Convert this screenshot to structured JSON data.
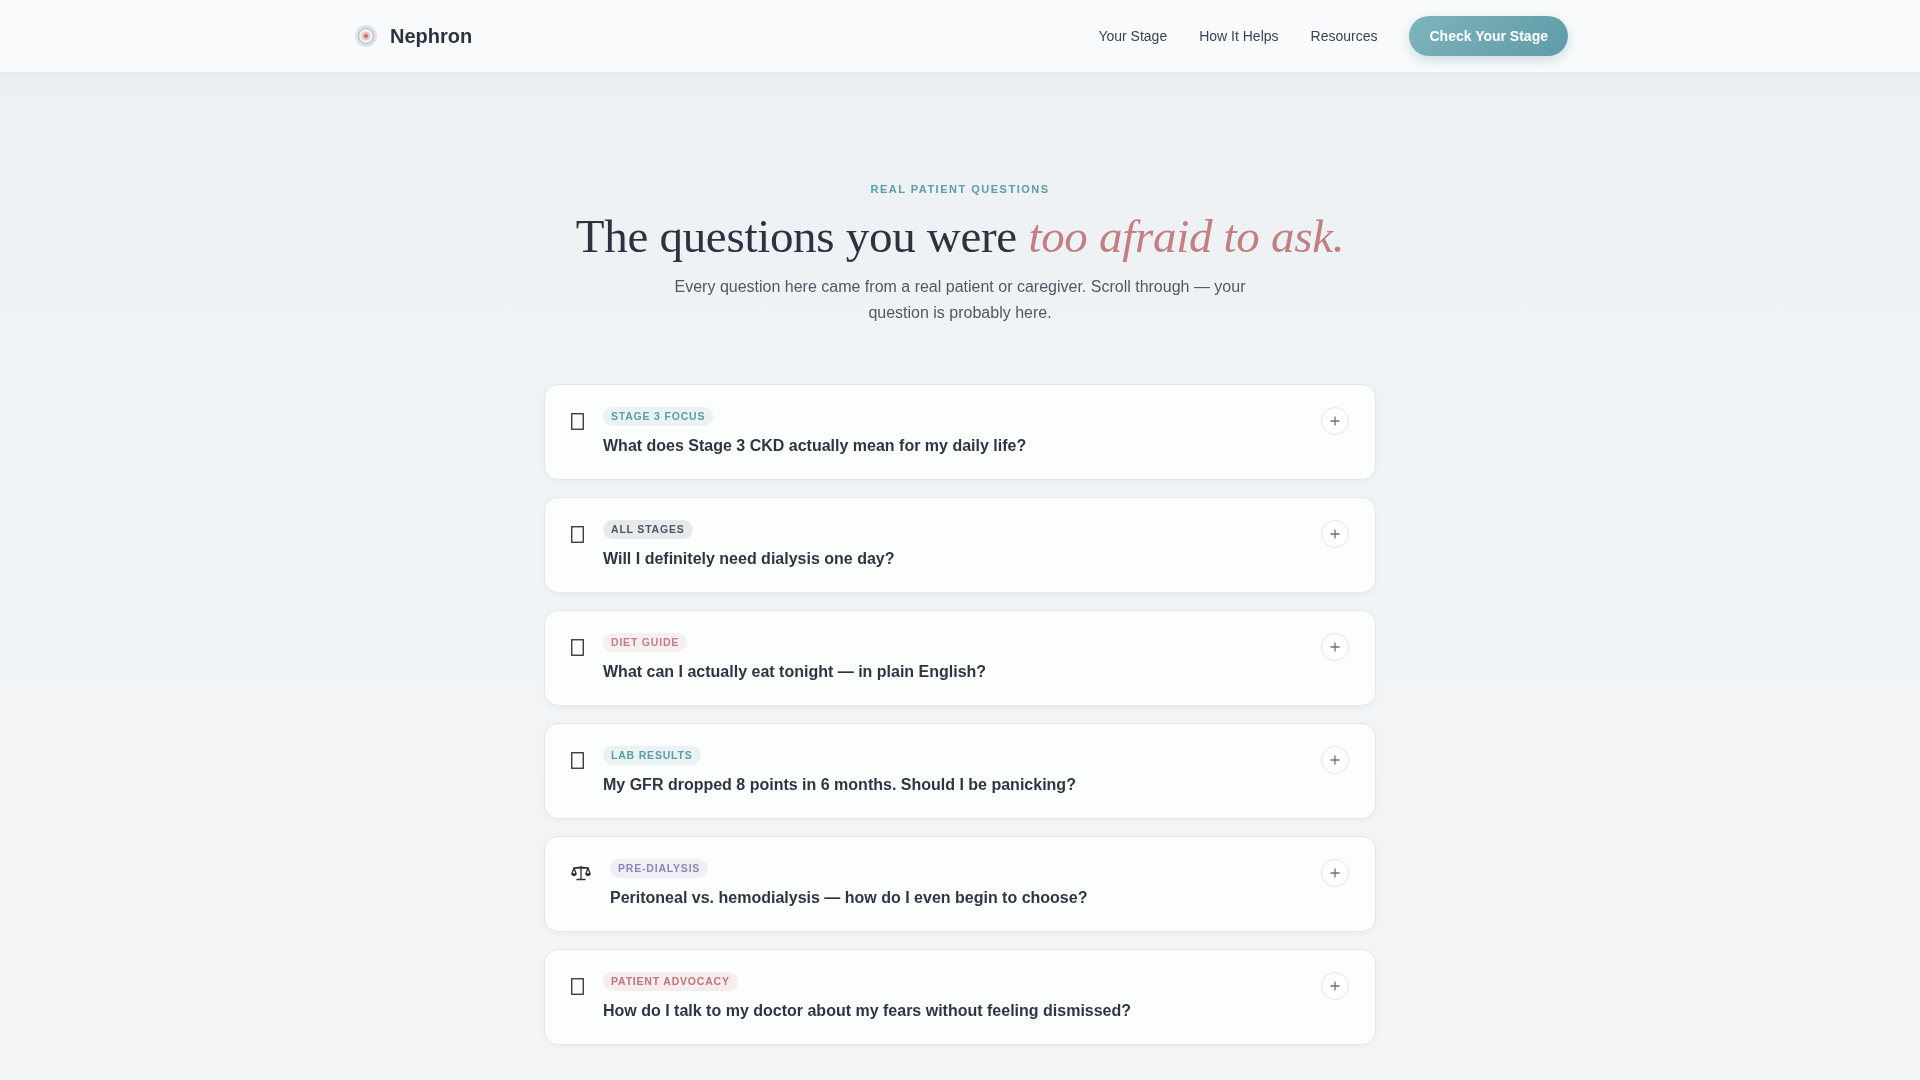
{
  "header": {
    "brand": "Nephron",
    "nav": [
      "Your Stage",
      "How It Helps",
      "Resources"
    ],
    "cta": "Check Your Stage"
  },
  "hero": {
    "eyebrow": "REAL PATIENT QUESTIONS",
    "title": "The questions you were *too afraid to ask.*",
    "subtitle": "Every question here came from a real patient or caregiver. Scroll through — your question is probably here."
  },
  "questions": [
    {
      "kind": "boxed",
      "tag": "STAGE 3 FOCUS",
      "color": "#5a9ea8",
      "question": "What does Stage 3 CKD actually mean for my daily life?",
      "expanded": false
    },
    {
      "kind": "boxed",
      "tag": "ALL STAGES",
      "color": "#4b5563",
      "question": "Will I definitely need dialysis one day?",
      "expanded": false
    },
    {
      "kind": "boxed",
      "tag": "DIET GUIDE",
      "color": "#c07f86",
      "question": "What can I actually eat tonight — in plain English?",
      "expanded": false
    },
    {
      "kind": "boxed",
      "tag": "LAB RESULTS",
      "color": "#5a9ea8",
      "question": "My GFR dropped 8 points in 6 months. Should I be panicking?",
      "expanded": false
    },
    {
      "kind": "scales",
      "tag": "PRE-DIALYSIS",
      "color": "#8e84bb",
      "question": "Peritoneal vs. hemodialysis — how do I even begin to choose?",
      "expanded": false
    },
    {
      "kind": "boxed",
      "tag": "PATIENT ADVOCACY",
      "color": "#c0737b",
      "question": "How do I talk to my doctor about my fears without feeling dismissed?",
      "expanded": false
    }
  ]
}
